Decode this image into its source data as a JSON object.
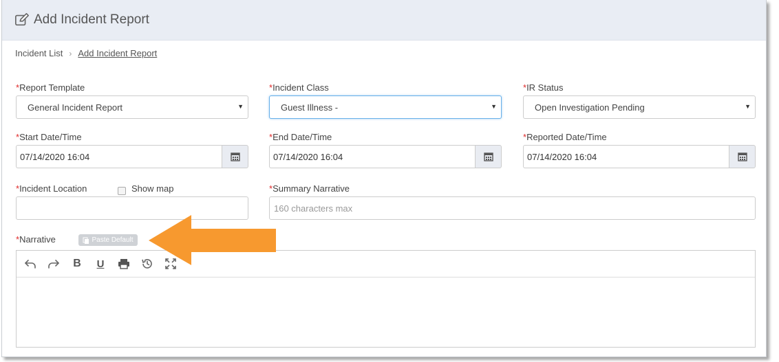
{
  "header": {
    "title": "Add Incident Report",
    "icon": "edit-icon"
  },
  "breadcrumb": {
    "items": [
      "Incident List",
      "Add Incident Report"
    ]
  },
  "form": {
    "required_mark": "*",
    "report_template": {
      "label": "Report Template",
      "value": "General Incident Report"
    },
    "incident_class": {
      "label": "Incident Class",
      "value": "Guest Illness -"
    },
    "ir_status": {
      "label": "IR Status",
      "value": "Open Investigation Pending"
    },
    "start_datetime": {
      "label": "Start Date/Time",
      "value": "07/14/2020 16:04"
    },
    "end_datetime": {
      "label": "End Date/Time",
      "value": "07/14/2020 16:04"
    },
    "reported_datetime": {
      "label": "Reported Date/Time",
      "value": "07/14/2020 16:04"
    },
    "incident_location": {
      "label": "Incident Location",
      "value": ""
    },
    "show_map": {
      "label": "Show map",
      "checked": false
    },
    "summary_narrative": {
      "label": "Summary Narrative",
      "placeholder": "160 characters max",
      "value": ""
    },
    "narrative": {
      "label": "Narrative",
      "paste_default_label": "Paste Default"
    }
  },
  "editor_toolbar": [
    "undo-icon",
    "redo-icon",
    "bold-icon",
    "underline-icon",
    "print-icon",
    "history-icon",
    "fullscreen-icon"
  ],
  "colors": {
    "header_bg": "#e9edf4",
    "required": "#e02b2b",
    "arrow": "#f7992f",
    "focus": "#66afe9"
  }
}
